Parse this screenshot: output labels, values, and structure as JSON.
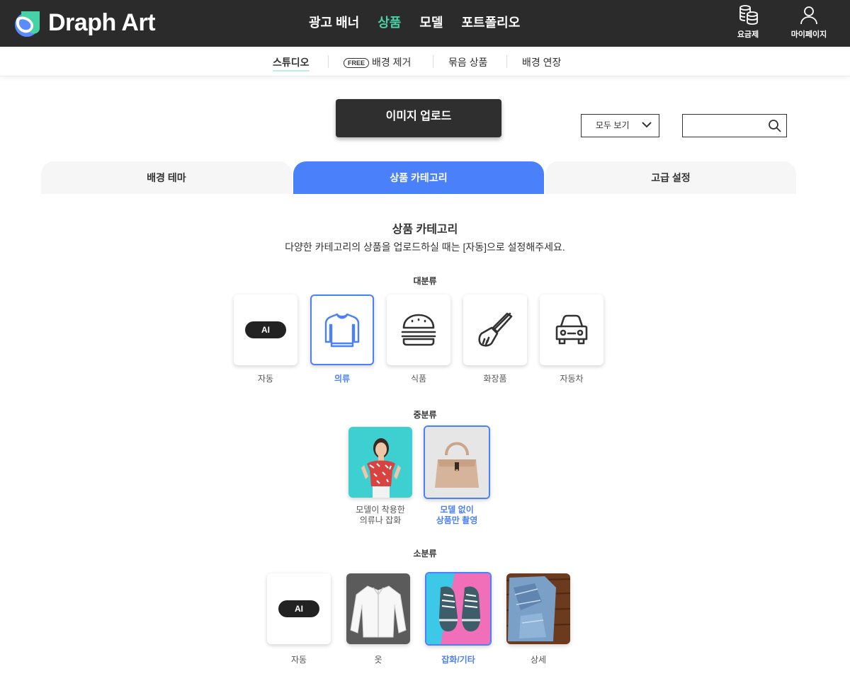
{
  "brand": {
    "name": "Draph Art"
  },
  "nav": {
    "items": [
      "광고 배너",
      "상품",
      "모델",
      "포트폴리오"
    ],
    "active": "상품"
  },
  "util": {
    "pricing": "요금제",
    "mypage": "마이페이지"
  },
  "subnav": {
    "studio": "스튜디오",
    "free_badge": "FREE",
    "bg_remove": "배경 제거",
    "bundle": "묶음 상품",
    "bg_extend": "배경 연장"
  },
  "toolbar": {
    "upload": "이미지 업로드",
    "filter_value": "모두 보기",
    "search_value": ""
  },
  "tabs": [
    "배경 테마",
    "상품 카테고리",
    "고급 설정"
  ],
  "section": {
    "title": "상품 카테고리",
    "desc": "다양한 카테고리의 상품을 업로드하실 때는 [자동]으로 설정해주세요."
  },
  "major": {
    "label": "대분류",
    "ai": "AI",
    "items": [
      "자동",
      "의류",
      "식품",
      "화장품",
      "자동차"
    ],
    "selected": "의류"
  },
  "middle": {
    "label": "중분류",
    "items": [
      {
        "line1": "모델이 착용한",
        "line2": "의류나 잡화"
      },
      {
        "line1": "모델 없이",
        "line2": "상품만 촬영"
      }
    ],
    "selected": "모델 없이 상품만 촬영"
  },
  "minor": {
    "label": "소분류",
    "ai": "AI",
    "items": [
      "자동",
      "옷",
      "잡화/기타",
      "상세"
    ],
    "selected": "잡화/기타"
  },
  "colors": {
    "accent": "#4b80fb",
    "nav_active": "#46d2a6",
    "topbar": "#2b2b2b"
  },
  "icons": [
    "logo-mark",
    "coins-icon",
    "user-icon",
    "chevron-down-icon",
    "search-icon",
    "shirt-icon",
    "burger-icon",
    "brush-icon",
    "car-icon"
  ]
}
